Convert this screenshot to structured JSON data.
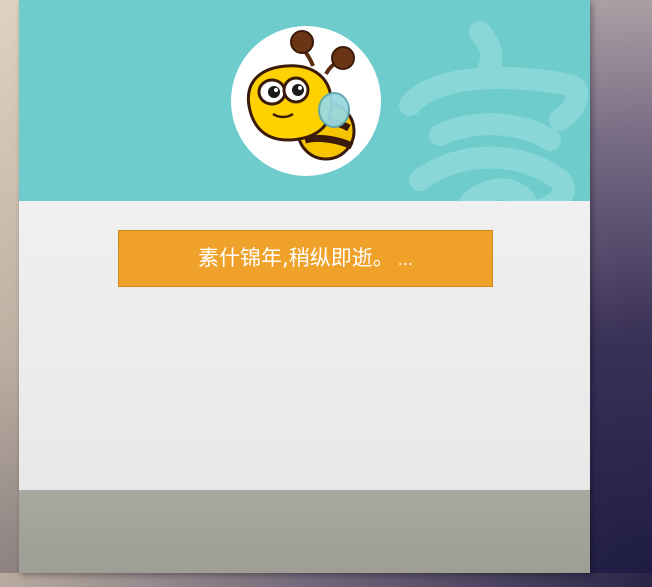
{
  "profile": {
    "avatar_icon": "bee-mascot-icon",
    "motto_text": "素什锦年,稍纵即逝。",
    "motto_ellipsis": "..."
  },
  "colors": {
    "header_bg": "#6ecccc",
    "button_bg": "#f0a12a",
    "content_bg": "#eeeeef",
    "footer_bg": "#a6a69c"
  }
}
